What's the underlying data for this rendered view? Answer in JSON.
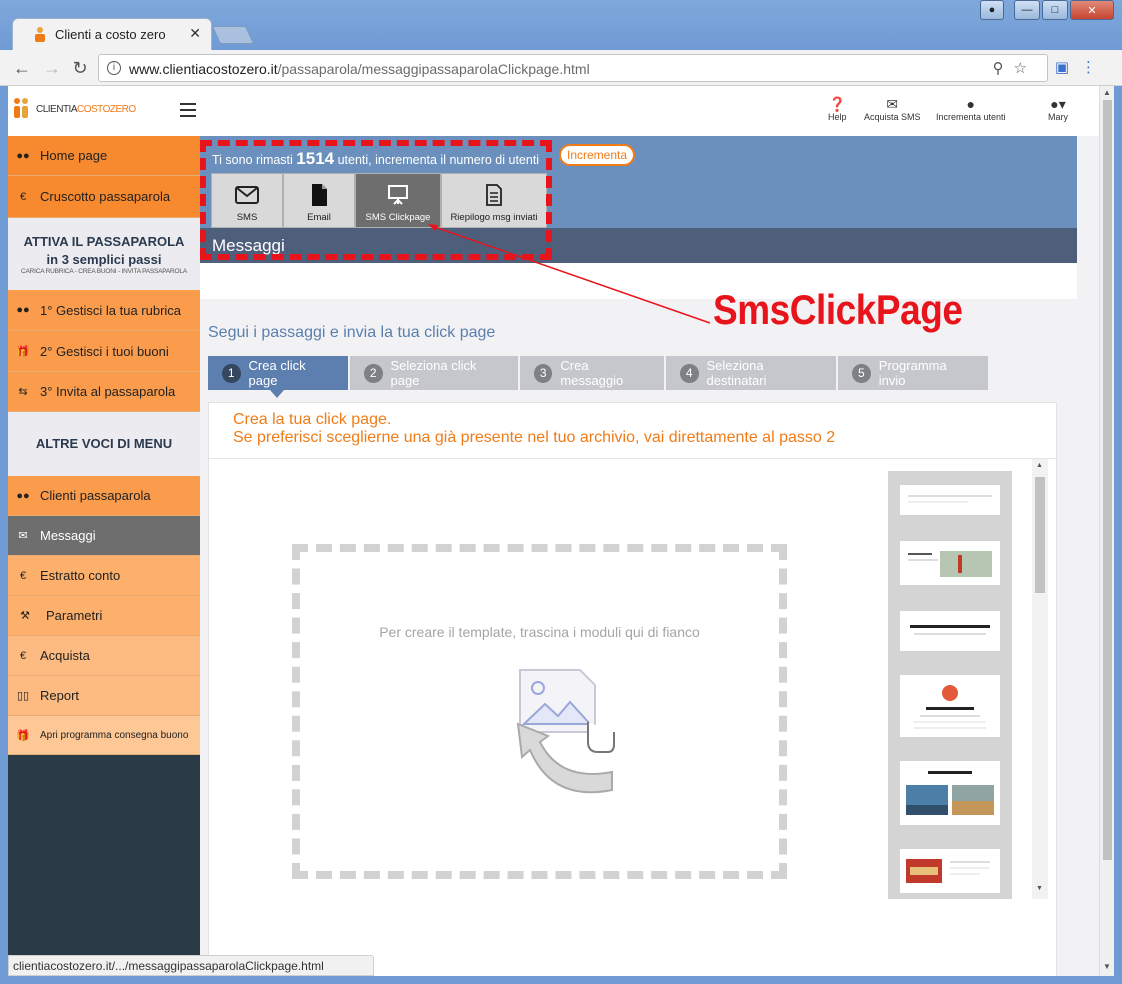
{
  "browser": {
    "tab_title": "Clienti a costo zero",
    "tab_close": "✕",
    "url_domain": "www.clientiacostozero.it",
    "url_path": "/passaparola/messaggipassaparolaClickpage.html",
    "status_url": "clientiacostozero.it/.../messaggipassaparolaClickpage.html"
  },
  "header": {
    "logo_text_a": "CLIENTIA",
    "logo_text_b": "COSTOZERO",
    "help": "Help",
    "acquista_sms": "Acquista SMS",
    "incrementa_utenti": "Incrementa utenti",
    "user": "Mary"
  },
  "sidebar": {
    "home": "Home page",
    "cruscotto": "Cruscotto passaparola",
    "attiva_title": "ATTIVA IL PASSAPAROLA",
    "attiva_sub": "in 3 semplici passi",
    "attiva_steps": "CARICA RUBRICA - CREA BUONI - INVITA PASSAPAROLA",
    "step1": "1°  Gestisci la tua rubrica",
    "step2": "2°  Gestisci i tuoi buoni",
    "step3": "3°  Invita al passaparola",
    "altre": "ALTRE VOCI DI MENU",
    "clienti": "Clienti passaparola",
    "messaggi": "Messaggi",
    "estratto": "Estratto conto",
    "parametri": "Parametri",
    "acquista": "Acquista",
    "report": "Report",
    "apri": "Apri programma consegna buono"
  },
  "band": {
    "text_before": "Ti sono rimasti ",
    "count": "1514",
    "text_after": " utenti, incrementa il numero di utenti",
    "incrementa": "Incrementa",
    "types": [
      "SMS",
      "Email",
      "SMS Clickpage",
      "Riepilogo msg inviati"
    ],
    "section_title": "Messaggi"
  },
  "annotation": {
    "label": "SmsClickPage",
    "color": "#e8141c"
  },
  "steps": {
    "title": "Segui i passaggi e invia la tua click page",
    "items": [
      {
        "num": "1",
        "label": "Crea click page"
      },
      {
        "num": "2",
        "label": "Seleziona click page"
      },
      {
        "num": "3",
        "label": "Crea messaggio"
      },
      {
        "num": "4",
        "label": "Seleziona destinatari"
      },
      {
        "num": "5",
        "label": "Programma invio"
      }
    ]
  },
  "panel": {
    "line1": "Crea la tua click page.",
    "line2": "Se preferisci sceglierne una già presente nel tuo archivio, vai direttamente al passo 2",
    "drop_text": "Per creare il template, trascina i moduli qui di fianco"
  },
  "colors": {
    "orange": "#f07c18",
    "band_blue": "#6b90bd",
    "active_step": "#5d7fb0"
  }
}
